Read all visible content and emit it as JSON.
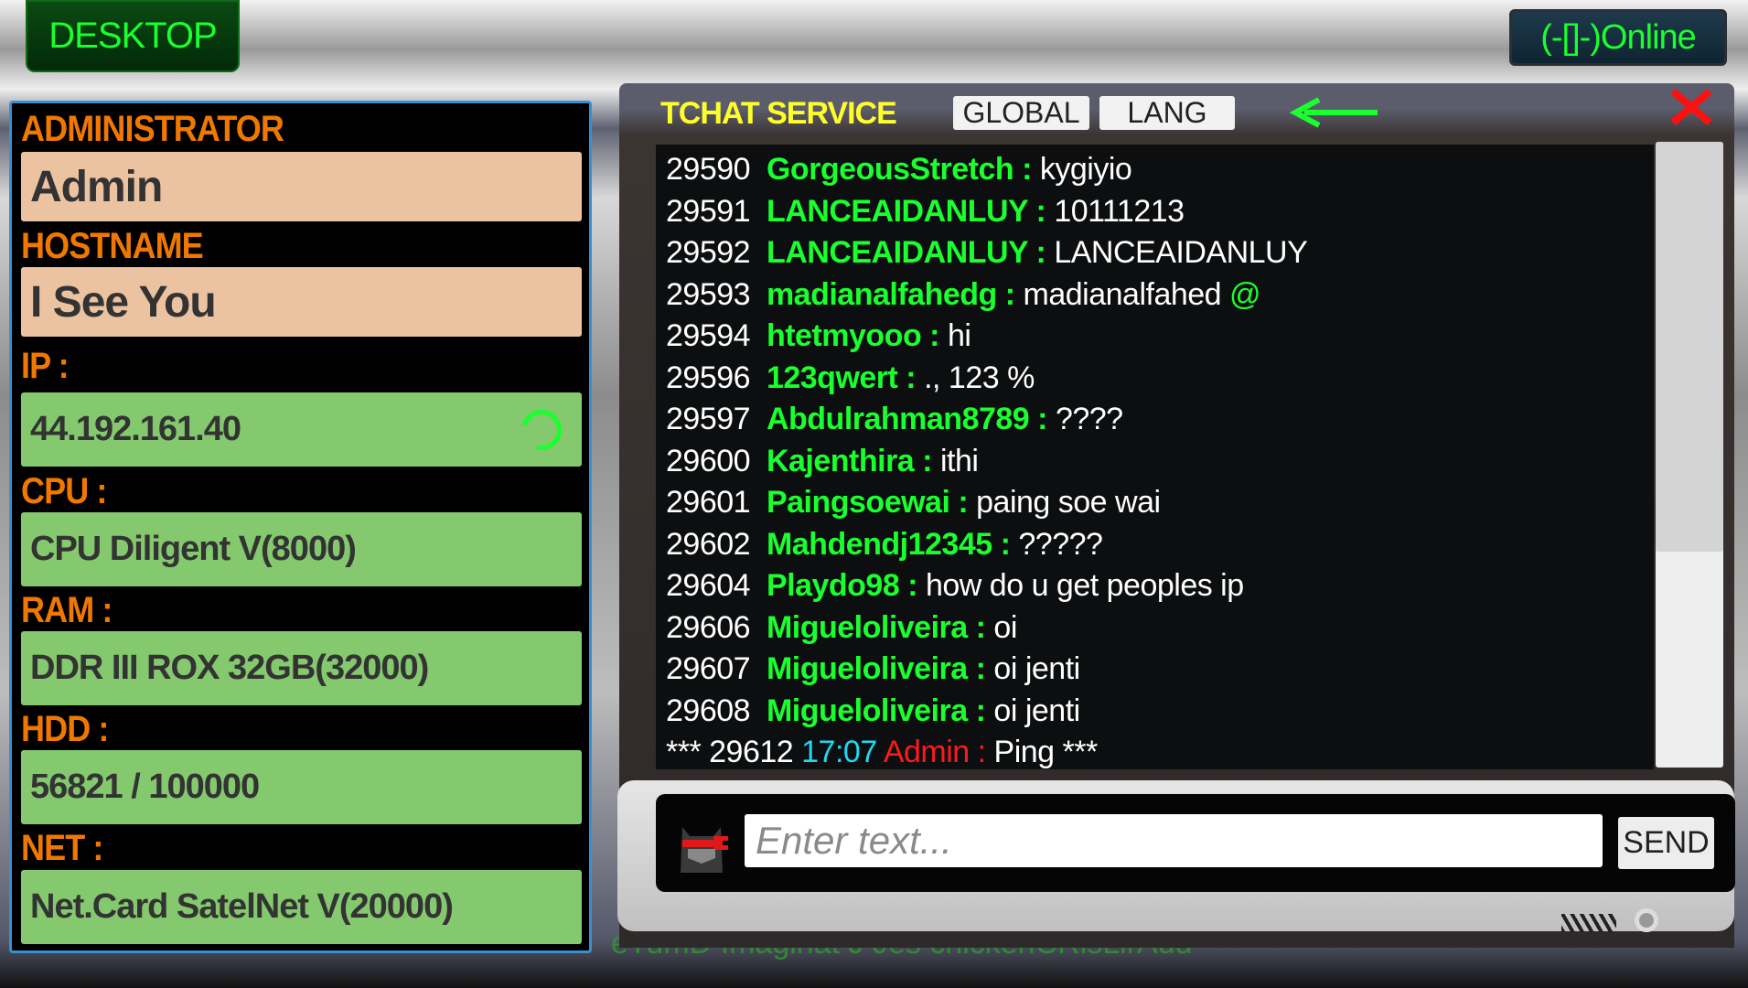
{
  "desktop_label": "DESKTOP",
  "status_label": "(-[]-)Online",
  "info": {
    "admin_label": "ADMINISTRATOR",
    "admin_value": "Admin",
    "hostname_label": "HOSTNAME",
    "hostname_value": "I See You",
    "ip_label": "IP :",
    "ip_value": "44.192.161.40",
    "cpu_label": "CPU :",
    "cpu_value": "CPU Diligent V(8000)",
    "ram_label": "RAM :",
    "ram_value": "DDR III ROX 32GB(32000)",
    "hdd_label": "HDD :",
    "hdd_value": "56821 / 100000",
    "net_label": "NET :",
    "net_value": "Net.Card SatelNet V(20000)"
  },
  "chat": {
    "title": "TCHAT SERVICE",
    "tabs": [
      "GLOBAL",
      "LANG"
    ],
    "messages": [
      {
        "id": "29590",
        "user": "GorgeousStretch :",
        "text": "kygiyio"
      },
      {
        "id": "29591",
        "user": "LANCEAIDANLUY :",
        "text": "10111213"
      },
      {
        "id": "29592",
        "user": "LANCEAIDANLUY :",
        "text": "LANCEAIDANLUY"
      },
      {
        "id": "29593",
        "user": "madianalfahedg :",
        "text": "madianalfahed",
        "mention": "@"
      },
      {
        "id": "29594",
        "user": "htetmyooo :",
        "text": "hi"
      },
      {
        "id": "29596",
        "user": "123qwert :",
        "text": "., 123 %"
      },
      {
        "id": "29597",
        "user": "Abdulrahman8789 :",
        "text": "????"
      },
      {
        "id": "29600",
        "user": "Kajenthira :",
        "text": "ithi"
      },
      {
        "id": "29601",
        "user": "Paingsoewai :",
        "text": "paing soe wai"
      },
      {
        "id": "29602",
        "user": "Mahdendj12345 :",
        "text": "?????"
      },
      {
        "id": "29604",
        "user": "Playdo98 :",
        "text": "how do u get peoples ip"
      },
      {
        "id": "29606",
        "user": "Migueloliveira :",
        "text": "oi"
      },
      {
        "id": "29607",
        "user": "Migueloliveira :",
        "text": "oi jenti"
      },
      {
        "id": "29608",
        "user": "Migueloliveira :",
        "text": "oi jenti"
      }
    ],
    "system": {
      "prefix": "*** 29612",
      "time": "17:07",
      "user": "Admin :",
      "text": "Ping ***"
    },
    "input_placeholder": "Enter text...",
    "send_label": "SEND",
    "ghost_text": "eTumD  Imaginat J Jes chickenCRisLirAud"
  },
  "colors": {
    "label": "#f07800",
    "user": "#1aff2e",
    "admin": "#ff1a1a",
    "time": "#20d8f0",
    "title": "#ffff2a"
  }
}
